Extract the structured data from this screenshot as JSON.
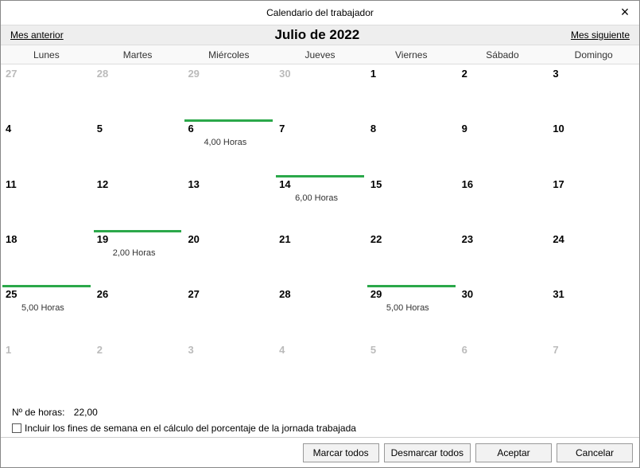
{
  "window": {
    "title": "Calendario del trabajador"
  },
  "nav": {
    "prev": "Mes anterior",
    "title": "Julio de 2022",
    "next": "Mes siguiente"
  },
  "dow": [
    "Lunes",
    "Martes",
    "Miércoles",
    "Jueves",
    "Viernes",
    "Sábado",
    "Domingo"
  ],
  "weeks": [
    [
      {
        "n": "27",
        "inactive": true
      },
      {
        "n": "28",
        "inactive": true
      },
      {
        "n": "29",
        "inactive": true
      },
      {
        "n": "30",
        "inactive": true
      },
      {
        "n": "1"
      },
      {
        "n": "2"
      },
      {
        "n": "3"
      }
    ],
    [
      {
        "n": "4"
      },
      {
        "n": "5"
      },
      {
        "n": "6",
        "marked": true,
        "hours": "4,00 Horas"
      },
      {
        "n": "7"
      },
      {
        "n": "8"
      },
      {
        "n": "9"
      },
      {
        "n": "10"
      }
    ],
    [
      {
        "n": "11"
      },
      {
        "n": "12"
      },
      {
        "n": "13"
      },
      {
        "n": "14",
        "marked": true,
        "hours": "6,00 Horas"
      },
      {
        "n": "15"
      },
      {
        "n": "16"
      },
      {
        "n": "17"
      }
    ],
    [
      {
        "n": "18"
      },
      {
        "n": "19",
        "marked": true,
        "hours": "2,00 Horas"
      },
      {
        "n": "20"
      },
      {
        "n": "21"
      },
      {
        "n": "22"
      },
      {
        "n": "23"
      },
      {
        "n": "24"
      }
    ],
    [
      {
        "n": "25",
        "marked": true,
        "hours": "5,00 Horas"
      },
      {
        "n": "26"
      },
      {
        "n": "27"
      },
      {
        "n": "28"
      },
      {
        "n": "29",
        "marked": true,
        "hours": "5,00 Horas"
      },
      {
        "n": "30"
      },
      {
        "n": "31"
      }
    ],
    [
      {
        "n": "1",
        "inactive": true
      },
      {
        "n": "2",
        "inactive": true
      },
      {
        "n": "3",
        "inactive": true
      },
      {
        "n": "4",
        "inactive": true
      },
      {
        "n": "5",
        "inactive": true
      },
      {
        "n": "6",
        "inactive": true
      },
      {
        "n": "7",
        "inactive": true
      }
    ]
  ],
  "footer": {
    "hours_label": "Nº de horas:",
    "hours_value": "22,00",
    "include_weekends_label": "Incluir los fines de semana en el cálculo del porcentaje de la jornada trabajada"
  },
  "buttons": {
    "mark_all": "Marcar todos",
    "unmark_all": "Desmarcar todos",
    "accept": "Aceptar",
    "cancel": "Cancelar"
  }
}
